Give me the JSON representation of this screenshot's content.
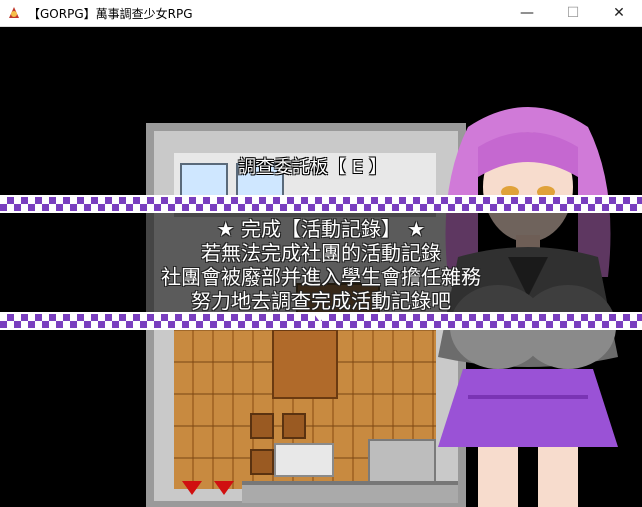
{
  "window": {
    "title": "【GORPG】萬事調查少女RPG",
    "minimize_symbol": "—",
    "maximize_symbol": "☐",
    "close_symbol": "✕",
    "icon": "game-app-icon"
  },
  "scene": {
    "sign_text": "調查委託板【 E 】"
  },
  "dialog": {
    "lines": [
      "★  完成【活動記錄】  ★",
      "若無法完成社團的活動記錄",
      "社團會被廢部并進入學生會擔任雜務",
      "努力地去調查完成活動記錄吧"
    ]
  },
  "colors": {
    "checker_purple": "#7a3fbf",
    "character_hair": "#d07ad8",
    "character_skirt": "#9a52d6"
  }
}
